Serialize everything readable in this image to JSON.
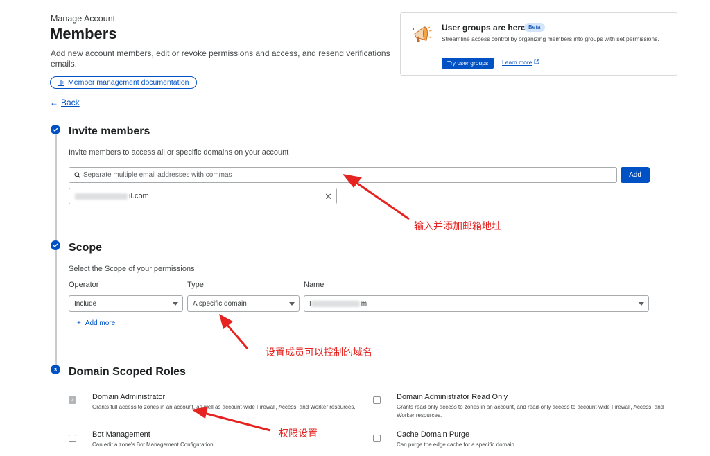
{
  "header": {
    "eyebrow": "Manage Account",
    "title": "Members",
    "description": "Add new account members, edit or revoke permissions and access, and resend verifications emails.",
    "doc_link": "Member management documentation",
    "back": "Back"
  },
  "promo": {
    "title": "User groups are here",
    "badge": "Beta",
    "description": "Streamline access control by organizing members into groups with set permissions.",
    "primary_button": "Try user groups",
    "link": "Learn more"
  },
  "invite": {
    "step": "",
    "title": "Invite members",
    "subtitle": "Invite members to access all or specific domains on your account",
    "placeholder": "Separate multiple email addresses with commas",
    "add_button": "Add",
    "chip_suffix": "il.com"
  },
  "scope": {
    "title": "Scope",
    "subtitle": "Select the Scope of your permissions",
    "operator_label": "Operator",
    "type_label": "Type",
    "name_label": "Name",
    "operator_value": "Include",
    "type_value": "A specific domain",
    "name_prefix": "I",
    "name_suffix": "m",
    "add_more": "Add more"
  },
  "roles": {
    "step": "3",
    "title": "Domain Scoped Roles",
    "items": [
      {
        "name": "Domain Administrator",
        "desc": "Grants full access to zones in an account, as well as account-wide Firewall, Access, and Worker resources.",
        "checked": true
      },
      {
        "name": "Domain Administrator Read Only",
        "desc": "Grants read-only access to zones in an account, and read-only access to account-wide Firewall, Access, and Worker resources.",
        "checked": false
      },
      {
        "name": "Bot Management",
        "desc": "Can edit a zone's Bot Management Configuration",
        "checked": false
      },
      {
        "name": "Cache Domain Purge",
        "desc": "Can purge the edge cache for a specific domain.",
        "checked": false
      }
    ]
  },
  "annotations": {
    "email": "输入并添加邮箱地址",
    "domain": "设置成员可以控制的域名",
    "roles": "权限设置",
    "color": "#e52421"
  }
}
